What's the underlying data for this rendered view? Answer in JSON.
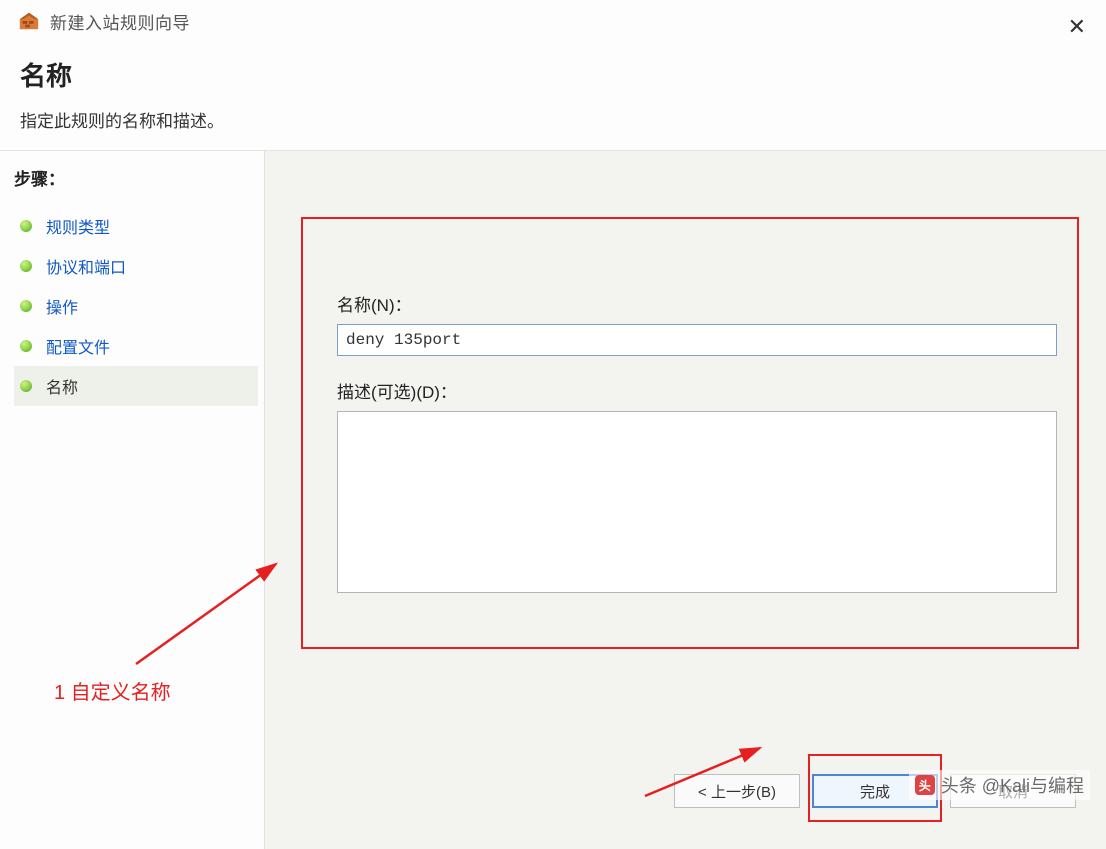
{
  "window": {
    "title": "新建入站规则向导"
  },
  "header": {
    "heading": "名称",
    "subtitle": "指定此规则的名称和描述。"
  },
  "sidebar": {
    "steps_label": "步骤：",
    "items": [
      {
        "label": "规则类型",
        "state": "link"
      },
      {
        "label": "协议和端口",
        "state": "link"
      },
      {
        "label": "操作",
        "state": "link"
      },
      {
        "label": "配置文件",
        "state": "link"
      },
      {
        "label": "名称",
        "state": "current"
      }
    ]
  },
  "form": {
    "name_label": "名称(N)：",
    "name_value": "deny 135port",
    "desc_label": "描述(可选)(D)：",
    "desc_value": ""
  },
  "buttons": {
    "back": "< 上一步(B)",
    "finish": "完成",
    "cancel": "取消"
  },
  "annotations": {
    "note1": "1 自定义名称"
  },
  "watermark": {
    "text": "头条 @Kali与编程"
  }
}
